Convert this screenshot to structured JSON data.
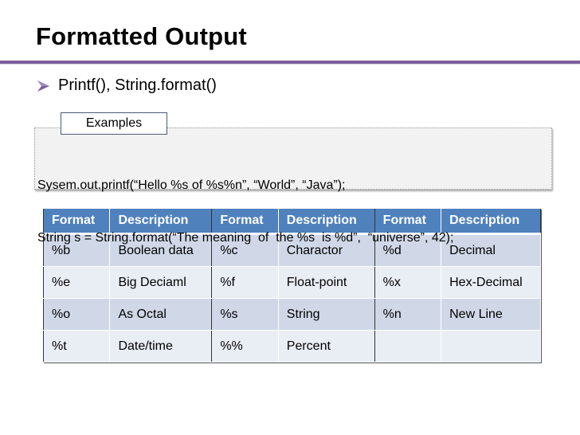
{
  "slide": {
    "title": "Formatted Output",
    "accent_color": "#7b5f9b",
    "header_color": "#4f81bd",
    "bullet": {
      "icon": "arrow-bullet-icon",
      "text": "Printf(), String.format()"
    },
    "examples": {
      "label": "Examples",
      "lines": [
        "Sysem.out.printf(“Hello %s of %s%n”, “World”, “Java”);",
        "String s = String.format(“The meaning  of  the %s  is %d”,  “universe”, 42);"
      ]
    },
    "table": {
      "headers": [
        "Format",
        "Description",
        "Format",
        "Description",
        "Format",
        "Description"
      ],
      "rows": [
        [
          "%b",
          "Boolean data",
          "%c",
          "Charactor",
          "%d",
          "Decimal"
        ],
        [
          "%e",
          "Big Deciaml",
          "%f",
          "Float-point",
          "%x",
          "Hex-Decimal"
        ],
        [
          "%o",
          "As Octal",
          "%s",
          "String",
          "%n",
          "New Line"
        ],
        [
          "%t",
          "Date/time",
          "%%",
          "Percent",
          "",
          ""
        ]
      ]
    }
  }
}
